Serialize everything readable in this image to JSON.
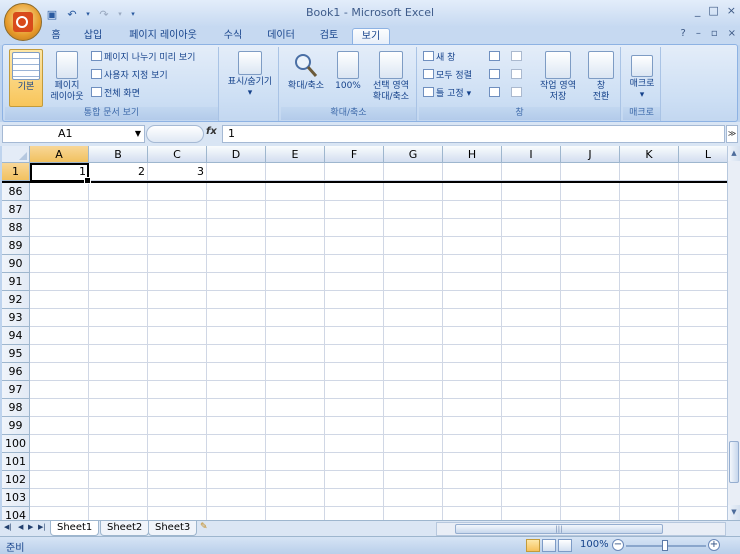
{
  "window": {
    "title": "Book1 - Microsoft Excel",
    "min": "_",
    "max": "□",
    "close": "×"
  },
  "tabs": [
    "홈",
    "삽입",
    "페이지 레이아웃",
    "수식",
    "데이터",
    "검토",
    "보기"
  ],
  "active_tab": "보기",
  "tab_right": {
    "help": "?",
    "min": "–",
    "restore": "▫",
    "close": "×"
  },
  "ribbon": {
    "workbook_views": {
      "label": "통합 문서 보기",
      "normal": "기본",
      "page_layout": [
        "페이지",
        "레이아웃"
      ],
      "page_break": "페이지 나누기 미리 보기",
      "custom_views": "사용자 지정 보기",
      "full_screen": "전체 화면"
    },
    "show_hide": {
      "label": "표시/숨기기",
      "arrow": "▾"
    },
    "zoom": {
      "label": "확대/축소",
      "zoom": "확대/축소",
      "hundred": "100%",
      "zoom_selection": [
        "선택 영역",
        "확대/축소"
      ]
    },
    "window": {
      "label": "창",
      "new_window": "새 창",
      "arrange_all": "모두 정렬",
      "freeze_panes": "틀 고정",
      "save_workspace": [
        "작업 영역",
        "저장"
      ],
      "switch_windows": [
        "창",
        "전환"
      ]
    },
    "macros": {
      "label": "매크로",
      "macros": "매크로"
    }
  },
  "formula_bar": {
    "name_box": "A1",
    "fx": "fx",
    "value": "1"
  },
  "columns": [
    "A",
    "B",
    "C",
    "D",
    "E",
    "F",
    "G",
    "H",
    "I",
    "J",
    "K",
    "L"
  ],
  "rows": [
    "1",
    "86",
    "87",
    "88",
    "89",
    "90",
    "91",
    "92",
    "93",
    "94",
    "95",
    "96",
    "97",
    "98",
    "99",
    "100",
    "101",
    "102",
    "103",
    "104"
  ],
  "cells": {
    "A1": "1",
    "B1": "2",
    "C1": "3"
  },
  "sheets": [
    "Sheet1",
    "Sheet2",
    "Sheet3"
  ],
  "active_sheet": "Sheet1",
  "status": {
    "ready": "준비",
    "zoom": "100%"
  }
}
